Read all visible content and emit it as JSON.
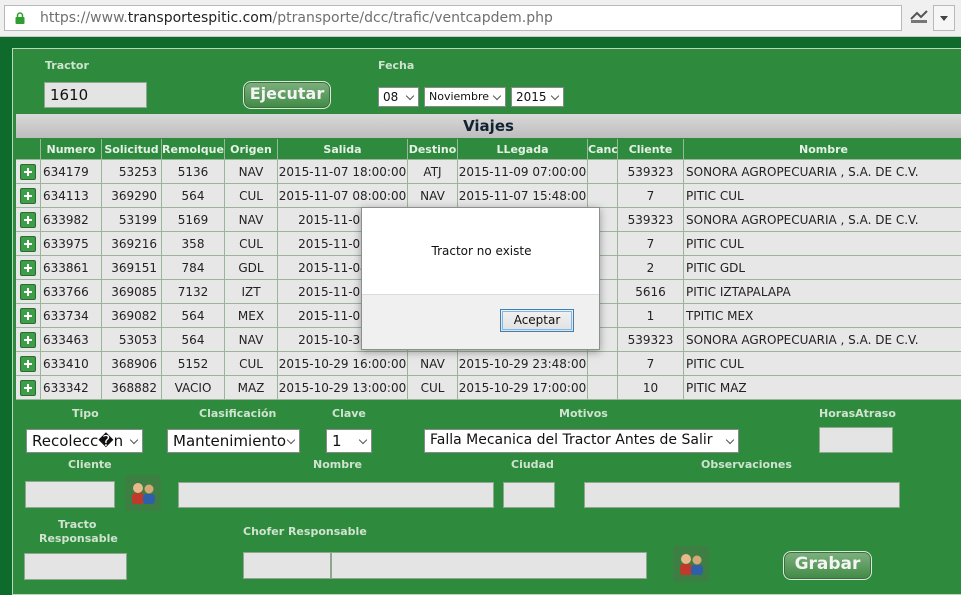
{
  "browser": {
    "url_prefix": "https://www.",
    "url_host": "transportespitic.com",
    "url_path": "/ptransporte/dcc/trafic/ventcapdem.php"
  },
  "form": {
    "tractor_label": "Tractor",
    "tractor_value": "1610",
    "fecha_label": "Fecha",
    "ejecutar_label": "Ejecutar",
    "day": "08",
    "month": "Noviembre",
    "year": "2015"
  },
  "viajes": {
    "title": "Viajes",
    "columns": [
      "Numero",
      "Solicitud",
      "Remolque",
      "Origen",
      "Salida",
      "Destino",
      "LLegada",
      "Canc",
      "Cliente",
      "Nombre"
    ],
    "rows": [
      [
        "634179",
        "53253",
        "5136",
        "NAV",
        "2015-11-07 18:00:00",
        "ATJ",
        "2015-11-09 07:00:00",
        "",
        "539323",
        "SONORA AGROPECUARIA , S.A. DE C.V."
      ],
      [
        "634113",
        "369290",
        "564",
        "CUL",
        "2015-11-07 08:00:00",
        "NAV",
        "2015-11-07 15:48:00",
        "",
        "7",
        "PITIC CUL"
      ],
      [
        "633982",
        "53199",
        "5169",
        "NAV",
        "2015-11-05 18",
        "",
        "",
        "",
        "539323",
        "SONORA AGROPECUARIA , S.A. DE C.V."
      ],
      [
        "633975",
        "369216",
        "358",
        "CUL",
        "2015-11-05 08",
        "",
        "",
        "",
        "7",
        "PITIC CUL"
      ],
      [
        "633861",
        "369151",
        "784",
        "GDL",
        "2015-11-04 19",
        "",
        "",
        "",
        "2",
        "PITIC GDL"
      ],
      [
        "633766",
        "369085",
        "7132",
        "IZT",
        "2015-11-03 19",
        "",
        "",
        "",
        "5616",
        "PITIC IZTAPALAPA"
      ],
      [
        "633734",
        "369082",
        "564",
        "MEX",
        "2015-11-03 16",
        "",
        "",
        "",
        "1",
        "TPITIC MEX"
      ],
      [
        "633463",
        "53053",
        "564",
        "NAV",
        "2015-10-30 18",
        "",
        "",
        "",
        "539323",
        "SONORA AGROPECUARIA , S.A. DE C.V."
      ],
      [
        "633410",
        "368906",
        "5152",
        "CUL",
        "2015-10-29 16:00:00",
        "NAV",
        "2015-10-29 23:48:00",
        "",
        "7",
        "PITIC CUL"
      ],
      [
        "633342",
        "368882",
        "VACIO",
        "MAZ",
        "2015-10-29 13:00:00",
        "CUL",
        "2015-10-29 17:00:00",
        "",
        "10",
        "PITIC MAZ"
      ]
    ]
  },
  "lower": {
    "tipo_label": "Tipo",
    "tipo_value": "Recolecc�n",
    "clasificacion_label": "Clasificación",
    "clasificacion_value": "Mantenimiento",
    "clave_label": "Clave",
    "clave_value": "1",
    "motivos_label": "Motivos",
    "motivos_value": "Falla Mecanica del Tractor Antes de Salir",
    "horas_label": "HorasAtraso",
    "cliente_label": "Cliente",
    "nombre_label": "Nombre",
    "ciudad_label": "Ciudad",
    "observaciones_label": "Observaciones",
    "tracto_label_1": "Tracto",
    "tracto_label_2": "Responsable",
    "chofer_label": "Chofer Responsable",
    "grabar_label": "Grabar"
  },
  "dialog": {
    "message": "Tractor no existe",
    "accept_label": "Aceptar"
  },
  "colors": {
    "panel_green": "#2e8b3e",
    "page_green": "#0f6b2c"
  }
}
